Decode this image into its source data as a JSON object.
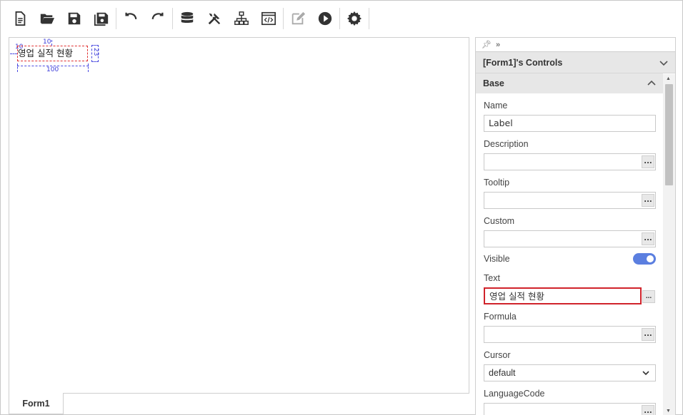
{
  "toolbar": {
    "groups": [
      [
        "new-file-icon",
        "open-folder-icon",
        "save-icon",
        "save-all-icon"
      ],
      [
        "undo-icon",
        "redo-icon"
      ],
      [
        "database-icon",
        "tools-icon",
        "hierarchy-icon",
        "code-view-icon"
      ],
      [
        "edit-icon",
        "run-icon"
      ],
      [
        "settings-icon"
      ]
    ]
  },
  "canvas": {
    "label_text": "영업 실적 현황",
    "dims": {
      "top": "10",
      "left": "10",
      "width": "100",
      "height": "23"
    }
  },
  "tabs": [
    {
      "label": "Form1"
    }
  ],
  "panel": {
    "header_title": "[Form1]'s Controls",
    "section_title": "Base",
    "properties": {
      "name": {
        "label": "Name",
        "value": "Label"
      },
      "description": {
        "label": "Description",
        "value": ""
      },
      "tooltip": {
        "label": "Tooltip",
        "value": ""
      },
      "custom": {
        "label": "Custom",
        "value": ""
      },
      "visible": {
        "label": "Visible",
        "value": true
      },
      "text": {
        "label": "Text",
        "value": "영업 실적 현황"
      },
      "formula": {
        "label": "Formula",
        "value": ""
      },
      "cursor": {
        "label": "Cursor",
        "value": "default"
      },
      "languagecode": {
        "label": "LanguageCode",
        "value": ""
      }
    },
    "ellipsis_label": "...",
    "accent_color": "#5b7fe0",
    "highlight_color": "#d0232b"
  }
}
